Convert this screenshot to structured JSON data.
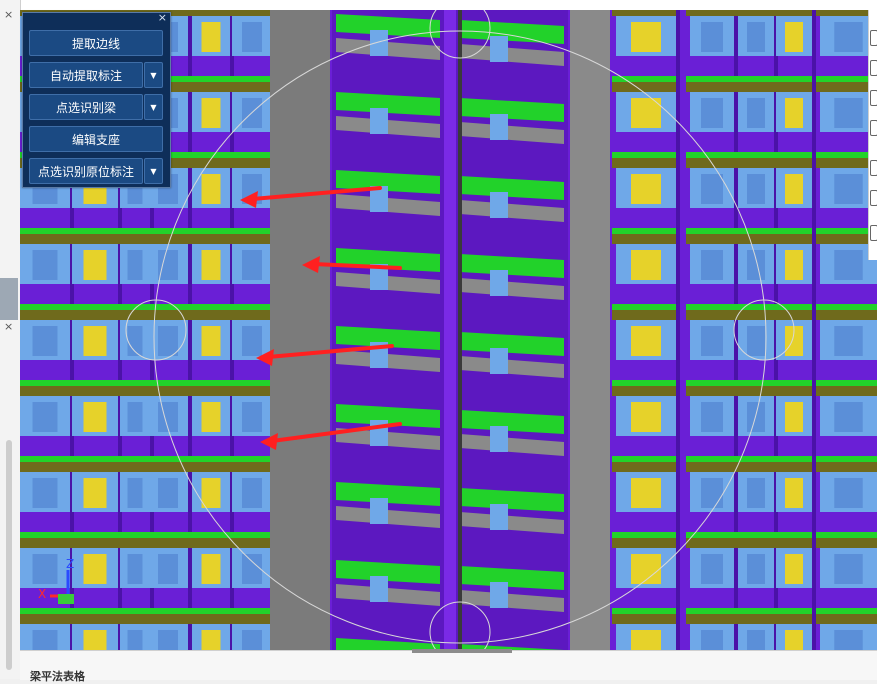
{
  "tool_panel": {
    "close_glyph": "×",
    "buttons": [
      {
        "label": "提取边线",
        "has_dropdown": false
      },
      {
        "label": "自动提取标注",
        "has_dropdown": true
      },
      {
        "label": "点选识别梁",
        "has_dropdown": true
      },
      {
        "label": "编辑支座",
        "has_dropdown": false
      },
      {
        "label": "点选识别原位标注",
        "has_dropdown": true
      }
    ],
    "dropdown_glyph": "▼"
  },
  "left_strip": {
    "close_glyph_top": "×",
    "close_glyph_mid": "×"
  },
  "axis_gizmo": {
    "x_label": "X",
    "z_label": "Z"
  },
  "bottom_panel": {
    "title": "梁平法表格"
  },
  "colors": {
    "column_purple": "#6a1fd6",
    "beam_green": "#22d22a",
    "wall_olive": "#6f6a1c",
    "window_blue": "#6fa8e8",
    "shaft_gray": "#7b7b7b",
    "core_gray": "#8a8a8a",
    "arrow_red": "#ff2020",
    "accent_yellow": "#e6d22a"
  }
}
